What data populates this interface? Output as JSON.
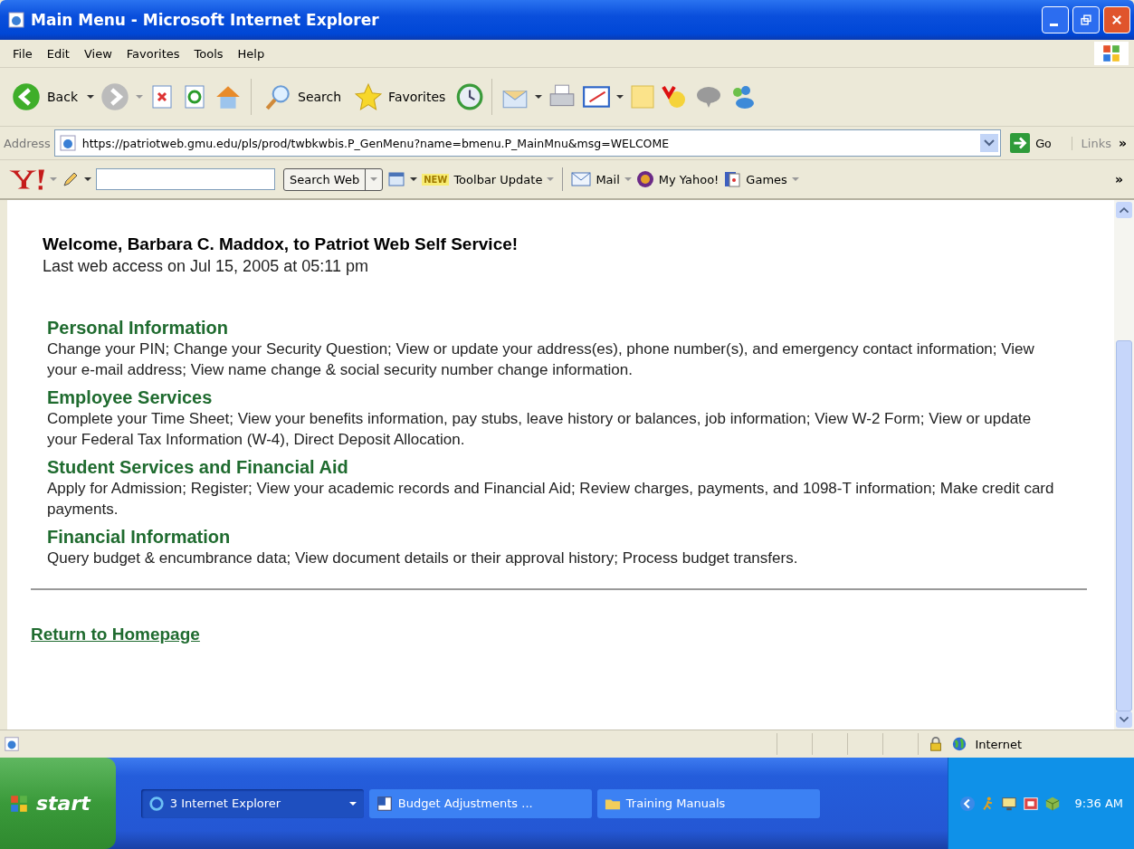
{
  "window": {
    "title": "Main Menu - Microsoft Internet Explorer"
  },
  "menu": [
    "File",
    "Edit",
    "View",
    "Favorites",
    "Tools",
    "Help"
  ],
  "toolbar": {
    "back": "Back",
    "search": "Search",
    "favorites": "Favorites"
  },
  "address": {
    "label": "Address",
    "url": "https://patriotweb.gmu.edu/pls/prod/twbkwbis.P_GenMenu?name=bmenu.P_MainMnu&msg=WELCOME",
    "go": "Go",
    "links": "Links",
    "more": "»"
  },
  "yahoo_toolbar": {
    "search_button": "Search Web",
    "new_badge": "NEW",
    "update": "Toolbar Update",
    "mail": "Mail",
    "my_yahoo": "My Yahoo!",
    "games": "Games",
    "more": "»"
  },
  "page": {
    "welcome": "Welcome, Barbara C. Maddox, to Patriot Web Self Service!",
    "last_access": "Last web access on Jul 15, 2005 at 05:11 pm",
    "sections": [
      {
        "title": "Personal Information",
        "description": "Change your PIN; Change your Security Question; View or update your address(es), phone number(s), and emergency contact information; View your e-mail address; View name change & social security number change information."
      },
      {
        "title": "Employee Services",
        "description": "Complete your Time Sheet; View your benefits information, pay stubs, leave history or balances, job information; View W-2 Form; View or update your Federal Tax Information (W-4), Direct Deposit Allocation."
      },
      {
        "title": "Student Services and Financial Aid",
        "description": "Apply for Admission; Register; View your academic records and Financial Aid; Review charges, payments, and 1098-T information; Make credit card payments."
      },
      {
        "title": "Financial Information",
        "description": "Query budget & encumbrance data; View document details or their approval history; Process budget transfers."
      }
    ],
    "return_link": "Return to Homepage"
  },
  "status_bar": {
    "zone": "Internet"
  },
  "taskbar": {
    "start": "start",
    "tasks": [
      {
        "label": "3 Internet Explorer",
        "kind": "group",
        "selected": true
      },
      {
        "label": "Budget Adjustments ...",
        "kind": "word",
        "selected": false
      },
      {
        "label": "Training Manuals",
        "kind": "folder",
        "selected": false
      }
    ],
    "clock": "9:36 AM"
  }
}
